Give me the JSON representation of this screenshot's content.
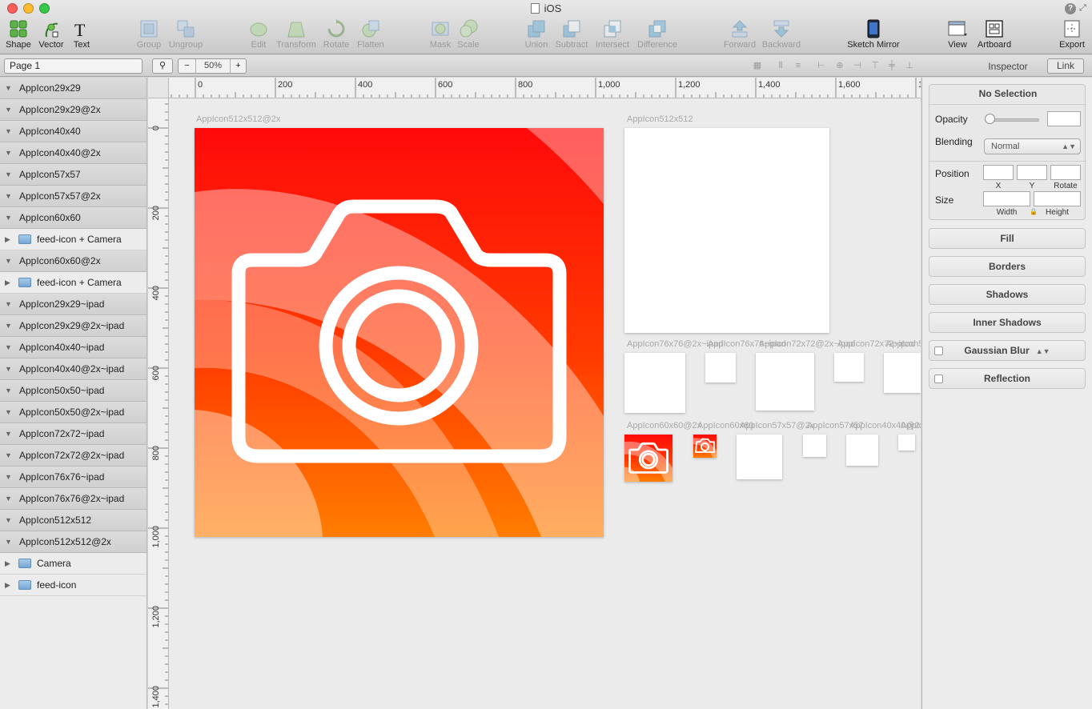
{
  "window": {
    "title": "iOS"
  },
  "toolbar": {
    "shape": "Shape",
    "vector": "Vector",
    "text": "Text",
    "group": "Group",
    "ungroup": "Ungroup",
    "edit": "Edit",
    "transform": "Transform",
    "rotate": "Rotate",
    "flatten": "Flatten",
    "mask": "Mask",
    "scale": "Scale",
    "union": "Union",
    "subtract": "Subtract",
    "intersect": "Intersect",
    "difference": "Difference",
    "forward": "Forward",
    "backward": "Backward",
    "sketch_mirror": "Sketch Mirror",
    "view": "View",
    "artboard": "Artboard",
    "export": "Export"
  },
  "subbar": {
    "page": "Page 1",
    "zoom_out": "−",
    "zoom_level": "50%",
    "zoom_in": "+",
    "inspector_tab": "Inspector",
    "link_tab": "Link"
  },
  "layers": [
    {
      "label": "AppIcon29x29",
      "kind": "artboard"
    },
    {
      "label": "AppIcon29x29@2x",
      "kind": "artboard"
    },
    {
      "label": "AppIcon40x40",
      "kind": "artboard"
    },
    {
      "label": "AppIcon40x40@2x",
      "kind": "artboard"
    },
    {
      "label": "AppIcon57x57",
      "kind": "artboard"
    },
    {
      "label": "AppIcon57x57@2x",
      "kind": "artboard"
    },
    {
      "label": "AppIcon60x60",
      "kind": "artboard"
    },
    {
      "label": "feed-icon + Camera",
      "kind": "group"
    },
    {
      "label": "AppIcon60x60@2x",
      "kind": "artboard"
    },
    {
      "label": "feed-icon + Camera",
      "kind": "group"
    },
    {
      "label": "AppIcon29x29~ipad",
      "kind": "artboard"
    },
    {
      "label": "AppIcon29x29@2x~ipad",
      "kind": "artboard"
    },
    {
      "label": "AppIcon40x40~ipad",
      "kind": "artboard"
    },
    {
      "label": "AppIcon40x40@2x~ipad",
      "kind": "artboard"
    },
    {
      "label": "AppIcon50x50~ipad",
      "kind": "artboard"
    },
    {
      "label": "AppIcon50x50@2x~ipad",
      "kind": "artboard"
    },
    {
      "label": "AppIcon72x72~ipad",
      "kind": "artboard"
    },
    {
      "label": "AppIcon72x72@2x~ipad",
      "kind": "artboard"
    },
    {
      "label": "AppIcon76x76~ipad",
      "kind": "artboard"
    },
    {
      "label": "AppIcon76x76@2x~ipad",
      "kind": "artboard"
    },
    {
      "label": "AppIcon512x512",
      "kind": "artboard"
    },
    {
      "label": "AppIcon512x512@2x",
      "kind": "artboard"
    },
    {
      "label": "Camera",
      "kind": "group"
    },
    {
      "label": "feed-icon",
      "kind": "group"
    }
  ],
  "ruler": {
    "h": [
      "0",
      "200",
      "400",
      "600",
      "800",
      "1,000",
      "1,200",
      "1,400",
      "1,600",
      "1"
    ],
    "v": [
      "0",
      "200",
      "400",
      "600",
      "800",
      "1,000",
      "1,200",
      "1,400"
    ]
  },
  "canvas": {
    "labels": {
      "big": "AppIcon512x512@2x",
      "ab512": "AppIcon512x512",
      "row1": [
        "AppIcon76x76@2x~ipad",
        "AppIcon76x76~ipad",
        "AppIcon72x72@2x~ipad",
        "AppIcon72x72~ipad",
        "AppIcon5"
      ],
      "row2": [
        "AppIcon60x60@2x",
        "AppIcon60x60",
        "AppIcon57x57@2x",
        "AppIcon57x57",
        "AppIcon40x40@2x",
        "AppIcon4"
      ]
    },
    "icon_colors": {
      "red": "#ff0000",
      "orange": "#ff7a00",
      "white": "#ffffff"
    }
  },
  "inspector": {
    "no_selection": "No Selection",
    "opacity": "Opacity",
    "blending": "Blending",
    "blending_value": "Normal",
    "position": "Position",
    "x": "X",
    "y": "Y",
    "rotate": "Rotate",
    "size": "Size",
    "width": "Width",
    "height": "Height",
    "fill": "Fill",
    "borders": "Borders",
    "shadows": "Shadows",
    "inner_shadows": "Inner Shadows",
    "gaussian_blur": "Gaussian Blur",
    "reflection": "Reflection"
  }
}
